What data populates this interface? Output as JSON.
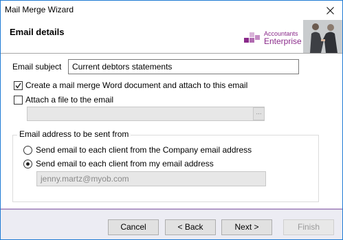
{
  "window": {
    "title": "Mail Merge Wizard"
  },
  "header": {
    "title": "Email details",
    "logo_line1": "Accountants",
    "logo_line2": "Enterprise"
  },
  "form": {
    "subject_label": "Email subject",
    "subject_value": "Current debtors statements",
    "create_doc_checkbox": {
      "label": "Create a mail merge Word document and attach to this email",
      "checked": true
    },
    "attach_file_checkbox": {
      "label": "Attach a file to the email",
      "checked": false
    },
    "attach_file_path": "",
    "browse_label": "...",
    "sender_group": {
      "legend": "Email address to be sent from",
      "option_company": {
        "label": "Send email to each client from the Company email address",
        "selected": false
      },
      "option_my": {
        "label": "Send email to each client from my email address",
        "selected": true
      },
      "my_email_value": "jenny.martz@myob.com"
    }
  },
  "footer": {
    "cancel": "Cancel",
    "back": "< Back",
    "next": "Next >",
    "finish": "Finish"
  },
  "colors": {
    "brand": "#8a2a8a",
    "window_border": "#1e7bd4",
    "footer_bg": "#ececf3"
  }
}
